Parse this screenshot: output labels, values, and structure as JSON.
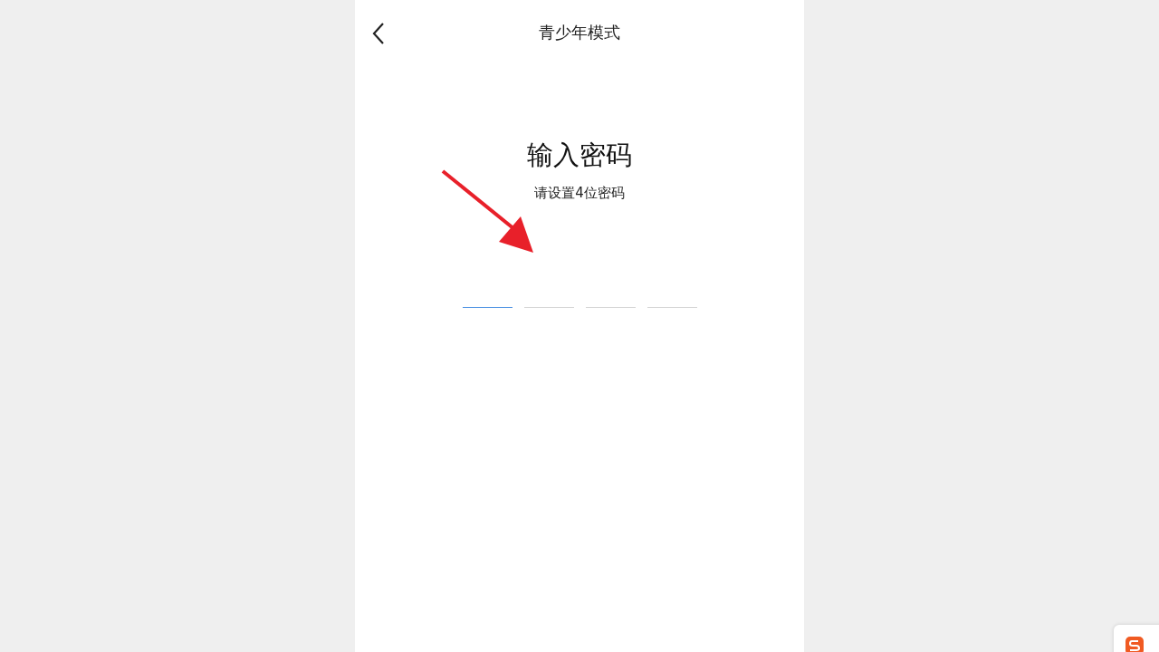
{
  "header": {
    "title": "青少年模式"
  },
  "heading": "输入密码",
  "hint": "请设置4位密码",
  "digits": [
    {
      "selected": true
    },
    {
      "selected": false
    },
    {
      "selected": false
    },
    {
      "selected": false
    }
  ]
}
